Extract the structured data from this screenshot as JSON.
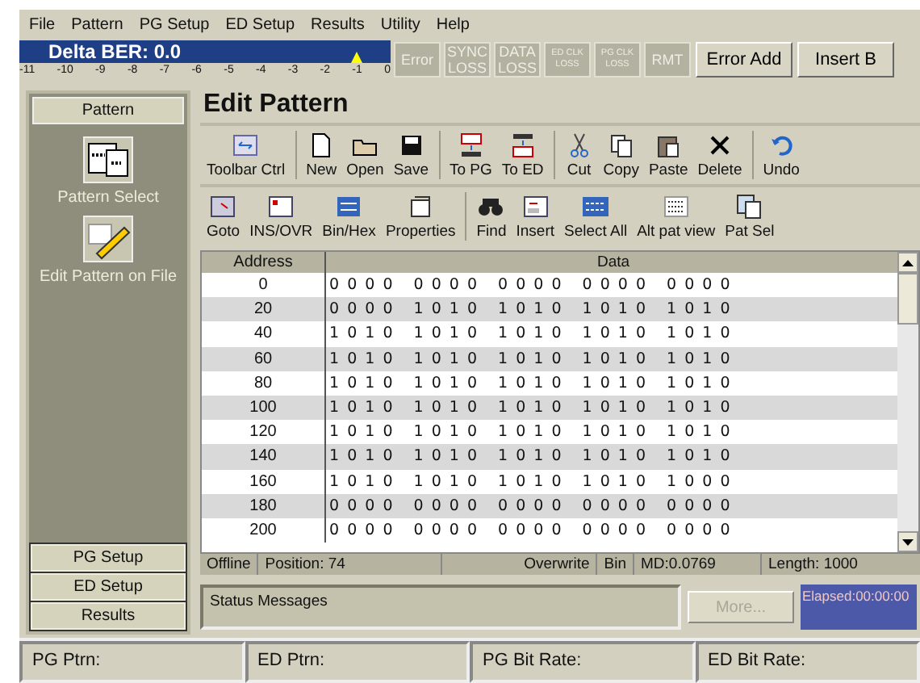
{
  "menu": [
    "File",
    "Pattern",
    "PG Setup",
    "ED Setup",
    "Results",
    "Utility",
    "Help"
  ],
  "ber": {
    "title": "Delta BER: 0.0",
    "scale": [
      "-11",
      "-10",
      "-9",
      "-8",
      "-7",
      "-6",
      "-5",
      "-4",
      "-3",
      "-2",
      "-1",
      "0"
    ],
    "level": 0.91
  },
  "indicators": [
    {
      "label": "Error",
      "active": false,
      "kind": "normal"
    },
    {
      "label": "SYNC LOSS",
      "active": false,
      "kind": "normal"
    },
    {
      "label": "DATA LOSS",
      "active": false,
      "kind": "normal"
    },
    {
      "label": "ED CLK LOSS",
      "active": false,
      "kind": "small"
    },
    {
      "label": "PG CLK LOSS",
      "active": false,
      "kind": "small"
    },
    {
      "label": "RMT",
      "active": false,
      "kind": "normal"
    }
  ],
  "top_buttons": [
    "Error Add",
    "Insert B"
  ],
  "sidebar": {
    "header": "Pattern",
    "items": [
      {
        "label": "Pattern Select"
      },
      {
        "label": "Edit Pattern on File"
      }
    ],
    "buttons": [
      "PG Setup",
      "ED Setup",
      "Results"
    ]
  },
  "title": "Edit Pattern",
  "toolbar1": [
    {
      "label": "Toolbar Ctrl",
      "separator_before": false
    },
    {
      "label": "New",
      "separator_before": true
    },
    {
      "label": "Open",
      "separator_before": false
    },
    {
      "label": "Save",
      "separator_before": false
    },
    {
      "label": "To PG",
      "separator_before": true
    },
    {
      "label": "To ED",
      "separator_before": false
    },
    {
      "label": "Cut",
      "separator_before": true
    },
    {
      "label": "Copy",
      "separator_before": false
    },
    {
      "label": "Paste",
      "separator_before": false
    },
    {
      "label": "Delete",
      "separator_before": false
    },
    {
      "label": "Undo",
      "separator_before": true
    }
  ],
  "toolbar2": [
    {
      "label": "Goto",
      "separator_before": false
    },
    {
      "label": "INS/OVR",
      "separator_before": false
    },
    {
      "label": "Bin/Hex",
      "separator_before": false
    },
    {
      "label": "Properties",
      "separator_before": false
    },
    {
      "label": "Find",
      "separator_before": true
    },
    {
      "label": "Insert",
      "separator_before": false
    },
    {
      "label": "Select All",
      "separator_before": false
    },
    {
      "label": "Alt pat view",
      "separator_before": false
    },
    {
      "label": "Pat Sel",
      "separator_before": false
    }
  ],
  "table": {
    "columns": [
      "Address",
      "Data"
    ],
    "rows": [
      {
        "address": "0",
        "data": [
          "0 0 0 0",
          "0 0 0 0",
          "0 0 0 0",
          "0 0 0 0",
          "0 0 0 0"
        ]
      },
      {
        "address": "20",
        "data": [
          "0 0 0 0",
          "1 0 1 0",
          "1 0 1 0",
          "1 0 1 0",
          "1 0 1 0"
        ]
      },
      {
        "address": "40",
        "data": [
          "1 0 1 0",
          "1 0 1 0",
          "1 0 1 0",
          "1 0 1 0",
          "1 0 1 0"
        ]
      },
      {
        "address": "60",
        "data": [
          "1 0 1 0",
          "1 0 1 0",
          "1 0 1 0",
          "1 0 1 0",
          "1 0 1 0"
        ]
      },
      {
        "address": "80",
        "data": [
          "1 0 1 0",
          "1 0 1 0",
          "1 0 1 0",
          "1 0 1 0",
          "1 0 1 0"
        ]
      },
      {
        "address": "100",
        "data": [
          "1 0 1 0",
          "1 0 1 0",
          "1 0 1 0",
          "1 0 1 0",
          "1 0 1 0"
        ]
      },
      {
        "address": "120",
        "data": [
          "1 0 1 0",
          "1 0 1 0",
          "1 0 1 0",
          "1 0 1 0",
          "1 0 1 0"
        ]
      },
      {
        "address": "140",
        "data": [
          "1 0 1 0",
          "1 0 1 0",
          "1 0 1 0",
          "1 0 1 0",
          "1 0 1 0"
        ]
      },
      {
        "address": "160",
        "data": [
          "1 0 1 0",
          "1 0 1 0",
          "1 0 1 0",
          "1 0 1 0",
          "1 0 0 0"
        ]
      },
      {
        "address": "180",
        "data": [
          "0 0 0 0",
          "0 0 0 0",
          "0 0 0 0",
          "0 0 0 0",
          "0 0 0 0"
        ]
      },
      {
        "address": "200",
        "data": [
          "0 0 0 0",
          "0 0 0 0",
          "0 0 0 0",
          "0 0 0 0",
          "0 0 0 0"
        ]
      }
    ]
  },
  "editor_status": [
    "Offline",
    "Position: 74",
    "Overwrite",
    "Bin",
    "MD:0.0769",
    "Length: 1000"
  ],
  "status_messages": {
    "label": "Status Messages",
    "more": "More...",
    "more_disabled": true,
    "elapsed": "Elapsed:00:00:00"
  },
  "status_bar": [
    "PG Ptrn:",
    "ED Ptrn:",
    "PG Bit Rate:",
    "ED Bit Rate:"
  ]
}
